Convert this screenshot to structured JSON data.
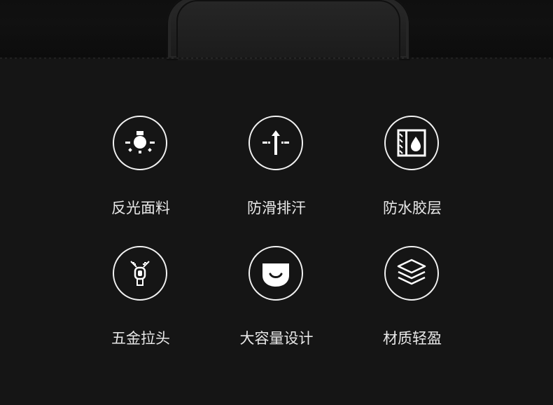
{
  "features": [
    {
      "label": "反光面料",
      "icon": "light-bulb-icon"
    },
    {
      "label": "防滑排汗",
      "icon": "arrow-up-icon"
    },
    {
      "label": "防水胶层",
      "icon": "water-drop-icon"
    },
    {
      "label": "五金拉头",
      "icon": "zipper-pull-icon"
    },
    {
      "label": "大容量设计",
      "icon": "pocket-smile-icon"
    },
    {
      "label": "材质轻盈",
      "icon": "layers-icon"
    }
  ]
}
